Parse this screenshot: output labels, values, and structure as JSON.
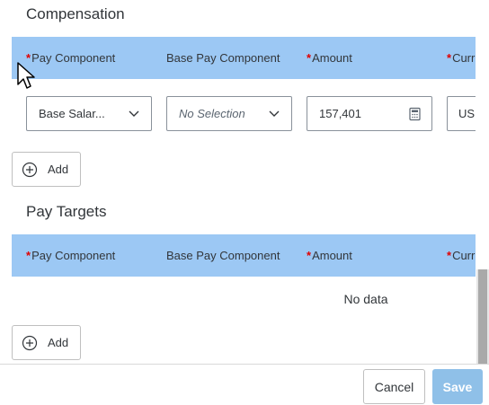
{
  "compensation": {
    "title": "Compensation",
    "columns": [
      {
        "label": "Pay Component",
        "required": "*"
      },
      {
        "label": "Base Pay Component",
        "required": ""
      },
      {
        "label": "Amount",
        "required": "*"
      },
      {
        "label": "Curr",
        "required": "*"
      }
    ],
    "row": {
      "pay_component": "Base Salar...",
      "base_pay_component": "No Selection",
      "amount": "157,401",
      "currency": "US"
    },
    "add_label": "Add"
  },
  "pay_targets": {
    "title": "Pay Targets",
    "columns": [
      {
        "label": "Pay Component",
        "required": "*"
      },
      {
        "label": "Base Pay Component",
        "required": ""
      },
      {
        "label": "Amount",
        "required": "*"
      },
      {
        "label": "Curr",
        "required": "*"
      }
    ],
    "empty_text": "No data",
    "add_label": "Add"
  },
  "footer": {
    "cancel_label": "Cancel",
    "save_label": "Save"
  },
  "colors": {
    "header_bg": "#9cc8f4",
    "required": "#e00000",
    "save_bg": "#8fc0e8"
  }
}
